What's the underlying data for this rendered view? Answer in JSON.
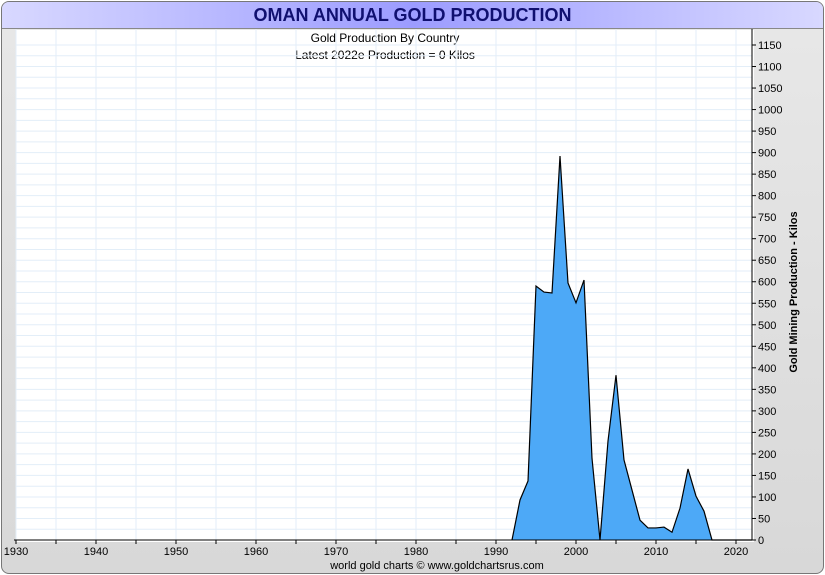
{
  "chart_data": {
    "type": "area",
    "title": "OMAN ANNUAL GOLD PRODUCTION",
    "subtitle": "Gold Production By Country",
    "annotation": "Latest 2022e Production = 0 Kilos",
    "ylabel": "Gold Mining Production - Kilos",
    "xlabel": "",
    "xlim": [
      1930,
      2022
    ],
    "ylim": [
      0,
      1150
    ],
    "x_ticks": [
      1930,
      1940,
      1950,
      1960,
      1970,
      1980,
      1990,
      2000,
      2010,
      2020
    ],
    "y_ticks": [
      0,
      50,
      100,
      150,
      200,
      250,
      300,
      350,
      400,
      450,
      500,
      550,
      600,
      650,
      700,
      750,
      800,
      850,
      900,
      950,
      1000,
      1050,
      1100,
      1150
    ],
    "grid": true,
    "fill_color": "#4da9f7",
    "line_color": "#000000",
    "x": [
      1992,
      1993,
      1994,
      1995,
      1996,
      1997,
      1998,
      1999,
      2000,
      2001,
      2002,
      2003,
      2004,
      2005,
      2006,
      2007,
      2008,
      2009,
      2010,
      2011,
      2012,
      2013,
      2014,
      2015,
      2016,
      2017,
      2018,
      2019,
      2020,
      2021,
      2022
    ],
    "values": [
      0,
      93,
      137,
      590,
      576,
      574,
      892,
      597,
      551,
      604,
      190,
      0,
      230,
      383,
      186,
      116,
      46,
      28,
      28,
      30,
      18,
      74,
      165,
      102,
      67,
      0,
      0,
      0,
      0,
      0,
      0
    ]
  },
  "footer": "world gold charts © www.goldchartsrus.com"
}
